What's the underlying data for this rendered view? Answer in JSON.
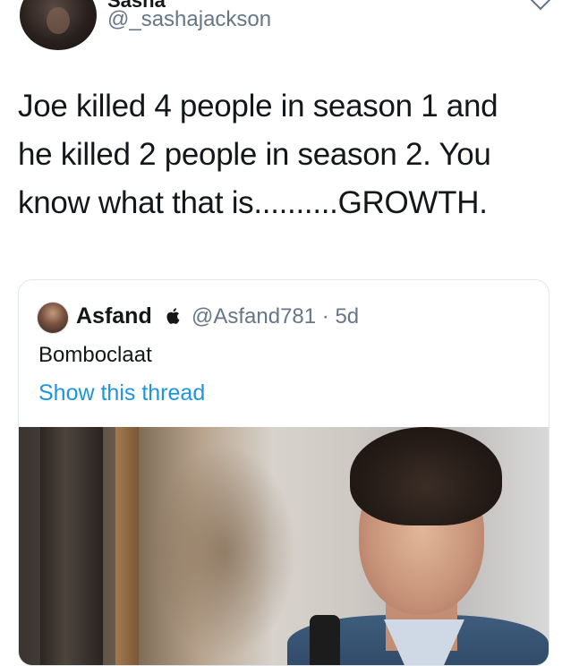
{
  "header": {
    "display_name": "Sasha",
    "handle": "@_sashajackson",
    "menu_icon": "chevron-down-icon"
  },
  "tweet": {
    "lines": [
      "Joe killed 4 people in season 1 and",
      "he killed 2 people in season 2. You",
      "know what that is..........GROWTH."
    ]
  },
  "quote": {
    "name": "Asfand",
    "badge_icon": "apple-icon",
    "handle_time": "@Asfand781 · 5d",
    "text": "Bomboclaat",
    "link": "Show this thread",
    "link_color": "#1b95e0"
  }
}
